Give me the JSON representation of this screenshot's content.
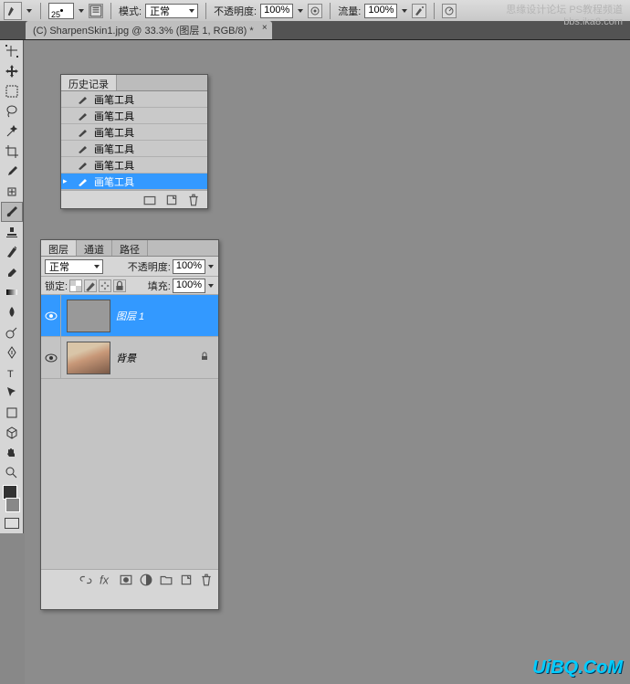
{
  "options_bar": {
    "brush_size": "25",
    "mode_label": "模式:",
    "mode_value": "正常",
    "opacity_label": "不透明度:",
    "opacity_value": "100%",
    "flow_label": "流量:",
    "flow_value": "100%"
  },
  "doc_tab": {
    "title": "(C) SharpenSkin1.jpg @ 33.3% (图层 1, RGB/8) *"
  },
  "history_panel": {
    "tab": "历史记录",
    "items": [
      {
        "label": "画笔工具",
        "active": false
      },
      {
        "label": "画笔工具",
        "active": false
      },
      {
        "label": "画笔工具",
        "active": false
      },
      {
        "label": "画笔工具",
        "active": false
      },
      {
        "label": "画笔工具",
        "active": false
      },
      {
        "label": "画笔工具",
        "active": true
      }
    ]
  },
  "layers_panel": {
    "tabs": [
      "图层",
      "通道",
      "路径"
    ],
    "blend_mode": "正常",
    "opacity_label": "不透明度:",
    "opacity_value": "100%",
    "lock_label": "锁定:",
    "fill_label": "填充:",
    "fill_value": "100%",
    "layers": [
      {
        "name": "图层 1",
        "active": true,
        "visible": true,
        "locked": false,
        "thumb": "hp"
      },
      {
        "name": "背景",
        "active": false,
        "visible": true,
        "locked": true,
        "thumb": "photo"
      }
    ]
  },
  "watermark": {
    "top_line1": "思缘设计论坛 PS教程频道",
    "top_line2": "bbs.ika8.com",
    "bottom": "UiBQ.CoM"
  }
}
